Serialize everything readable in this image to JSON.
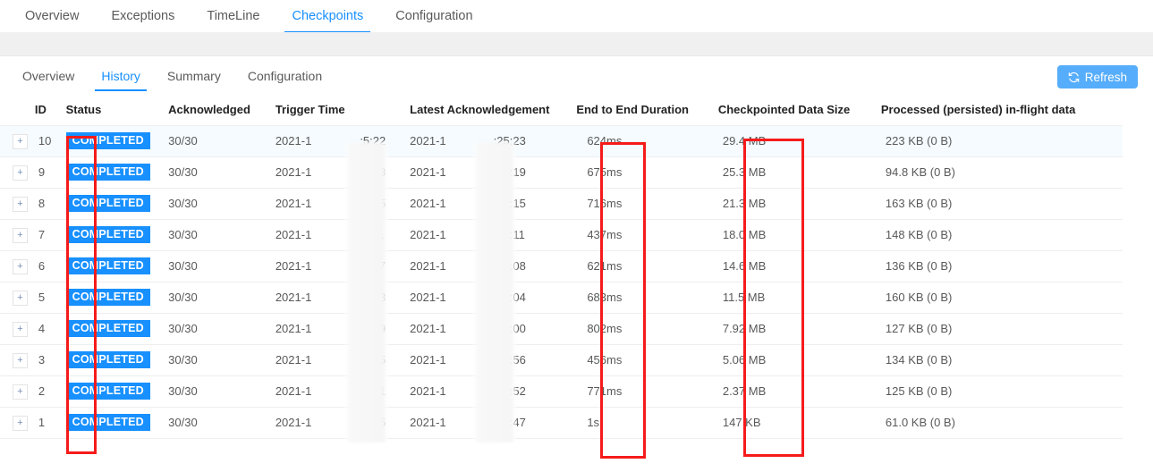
{
  "top_tabs": [
    {
      "label": "Overview",
      "active": false
    },
    {
      "label": "Exceptions",
      "active": false
    },
    {
      "label": "TimeLine",
      "active": false
    },
    {
      "label": "Checkpoints",
      "active": true
    },
    {
      "label": "Configuration",
      "active": false
    }
  ],
  "sub_tabs": [
    {
      "label": "Overview",
      "active": false
    },
    {
      "label": "History",
      "active": true
    },
    {
      "label": "Summary",
      "active": false
    },
    {
      "label": "Configuration",
      "active": false
    }
  ],
  "toolbar": {
    "refresh_label": "Refresh",
    "refresh_icon": "refresh-icon"
  },
  "table": {
    "columns": [
      "ID",
      "Status",
      "Acknowledged",
      "Trigger Time",
      "Latest Acknowledgement",
      "End to End Duration",
      "Checkpointed Data Size",
      "Processed (persisted) in-flight data"
    ],
    "expand_symbol": "+",
    "rows": [
      {
        "id": "10",
        "status": "COMPLETED",
        "acknowledged": "30/30",
        "trigger_time_prefix": "2021-1",
        "trigger_time_suffix": ":5:22",
        "latest_ack_prefix": "2021-1",
        "latest_ack_suffix": ":25:23",
        "duration": "624ms",
        "data_size": "29.4 MB",
        "processed": "223 KB (0 B)"
      },
      {
        "id": "9",
        "status": "COMPLETED",
        "acknowledged": "30/30",
        "trigger_time_prefix": "2021-1",
        "trigger_time_suffix": ":5:18",
        "latest_ack_prefix": "2021-1",
        "latest_ack_suffix": ":25:19",
        "duration": "675ms",
        "data_size": "25.3 MB",
        "processed": "94.8 KB (0 B)"
      },
      {
        "id": "8",
        "status": "COMPLETED",
        "acknowledged": "30/30",
        "trigger_time_prefix": "2021-1",
        "trigger_time_suffix": ":5:15",
        "latest_ack_prefix": "2021-1",
        "latest_ack_suffix": ":25:15",
        "duration": "716ms",
        "data_size": "21.3 MB",
        "processed": "163 KB (0 B)"
      },
      {
        "id": "7",
        "status": "COMPLETED",
        "acknowledged": "30/30",
        "trigger_time_prefix": "2021-1",
        "trigger_time_suffix": ":5:11",
        "latest_ack_prefix": "2021-1",
        "latest_ack_suffix": ":25:11",
        "duration": "437ms",
        "data_size": "18.0 MB",
        "processed": "148 KB (0 B)"
      },
      {
        "id": "6",
        "status": "COMPLETED",
        "acknowledged": "30/30",
        "trigger_time_prefix": "2021-1",
        "trigger_time_suffix": ":5:07",
        "latest_ack_prefix": "2021-1",
        "latest_ack_suffix": ":25:08",
        "duration": "621ms",
        "data_size": "14.6 MB",
        "processed": "136 KB (0 B)"
      },
      {
        "id": "5",
        "status": "COMPLETED",
        "acknowledged": "30/30",
        "trigger_time_prefix": "2021-1",
        "trigger_time_suffix": ":5:03",
        "latest_ack_prefix": "2021-1",
        "latest_ack_suffix": ":25:04",
        "duration": "683ms",
        "data_size": "11.5 MB",
        "processed": "160 KB (0 B)"
      },
      {
        "id": "4",
        "status": "COMPLETED",
        "acknowledged": "30/30",
        "trigger_time_prefix": "2021-1",
        "trigger_time_suffix": ":4:59",
        "latest_ack_prefix": "2021-1",
        "latest_ack_suffix": ":25:00",
        "duration": "802ms",
        "data_size": "7.92 MB",
        "processed": "127 KB (0 B)"
      },
      {
        "id": "3",
        "status": "COMPLETED",
        "acknowledged": "30/30",
        "trigger_time_prefix": "2021-1",
        "trigger_time_suffix": ":4:55",
        "latest_ack_prefix": "2021-1",
        "latest_ack_suffix": ":24:56",
        "duration": "456ms",
        "data_size": "5.06 MB",
        "processed": "134 KB (0 B)"
      },
      {
        "id": "2",
        "status": "COMPLETED",
        "acknowledged": "30/30",
        "trigger_time_prefix": "2021-1",
        "trigger_time_suffix": ":4:51",
        "latest_ack_prefix": "2021-1",
        "latest_ack_suffix": ":24:52",
        "duration": "771ms",
        "data_size": "2.37 MB",
        "processed": "125 KB (0 B)"
      },
      {
        "id": "1",
        "status": "COMPLETED",
        "acknowledged": "30/30",
        "trigger_time_prefix": "2021-1",
        "trigger_time_suffix": ":4:45",
        "latest_ack_prefix": "2021-1",
        "latest_ack_suffix": ":24:47",
        "duration": "1s",
        "data_size": "147 KB",
        "processed": "61.0 KB (0 B)"
      }
    ]
  },
  "annotations": [
    {
      "name": "id-column-highlight",
      "color": "#f61b1b"
    },
    {
      "name": "duration-column-highlight",
      "color": "#f61b1b"
    },
    {
      "name": "data-size-column-highlight",
      "color": "#f61b1b"
    }
  ],
  "colors": {
    "accent": "#1890ff",
    "refresh_button": "#56adfb",
    "annotation": "#f61b1b",
    "band": "#f0f0f0",
    "row_highlight": "#f5fbff"
  }
}
